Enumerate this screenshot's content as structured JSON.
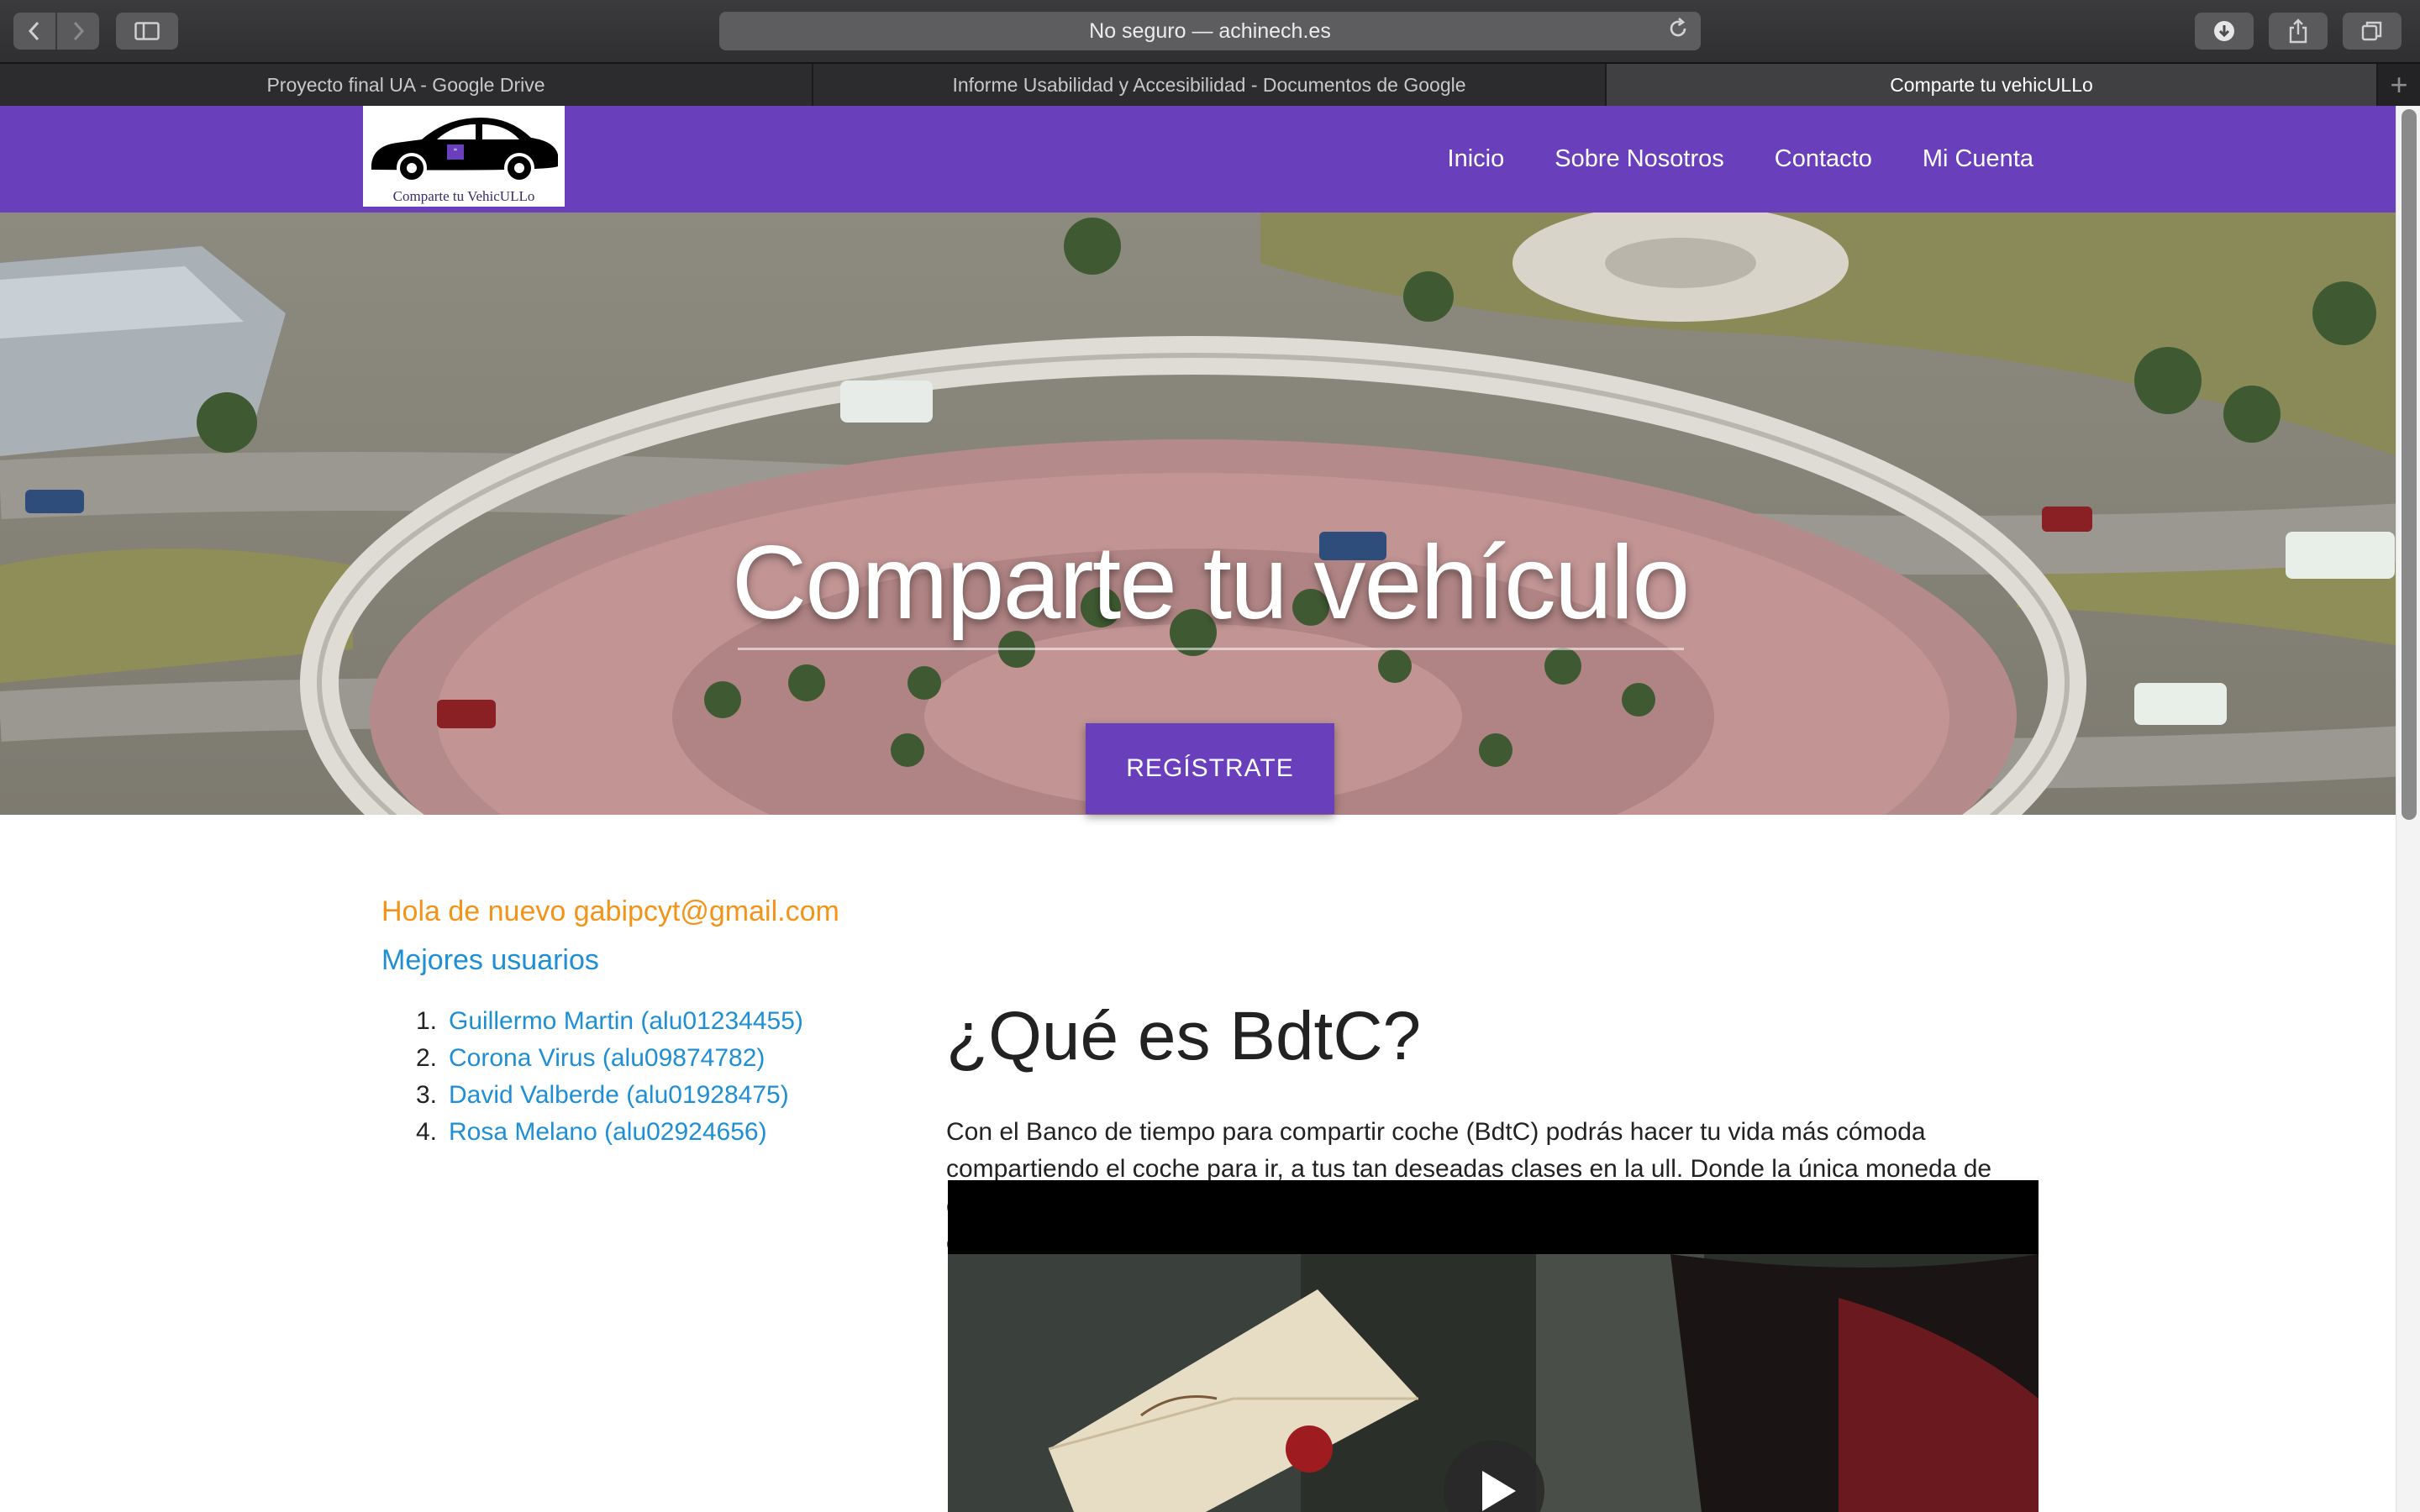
{
  "browser": {
    "address": "No seguro — achinech.es",
    "tabs": [
      {
        "label": "Proyecto final UA - Google Drive",
        "active": false
      },
      {
        "label": "Informe Usabilidad y Accesibilidad - Documentos de Google",
        "active": false
      },
      {
        "label": "Comparte tu vehicULLo",
        "active": true
      }
    ],
    "icons": {
      "back": "chevron-left-icon",
      "forward": "chevron-right-icon",
      "sidebar": "sidebar-icon",
      "reload": "reload-icon",
      "download": "download-icon",
      "share": "share-icon",
      "tabs": "tabs-overview-icon",
      "new_tab": "plus-icon"
    }
  },
  "site": {
    "logo_text": "Comparte tu VehicULLo",
    "nav": [
      "Inicio",
      "Sobre Nosotros",
      "Contacto",
      "Mi Cuenta"
    ],
    "brand_color": "#6a3fbc"
  },
  "hero": {
    "title": "Comparte tu vehículo",
    "cta": "REGÍSTRATE"
  },
  "sidebar": {
    "greeting": "Hola de nuevo gabipcyt@gmail.com",
    "best_users_title": "Mejores usuarios",
    "best_users": [
      {
        "num": "1.",
        "name": "Guillermo Martin (alu01234455)"
      },
      {
        "num": "2.",
        "name": "Corona Virus (alu09874782)"
      },
      {
        "num": "3.",
        "name": "David Valberde (alu01928475)"
      },
      {
        "num": "4.",
        "name": "Rosa Melano (alu02924656)"
      }
    ],
    "greeting_color": "#f39418",
    "link_color": "#1e8fd6"
  },
  "main": {
    "heading": "¿Qué es BdtC?",
    "description": "Con el Banco de tiempo para compartir coche (BdtC) podrás hacer tu vida más cómoda compartiendo el coche para ir, a tus tan deseadas clases en la ull. Donde la única moneda de cambio es el tiempo, intercambiando el viaje entre tu coche y el de tus compañeros. La aplicación es completamente gratuita.",
    "video_icon": "play-icon"
  }
}
